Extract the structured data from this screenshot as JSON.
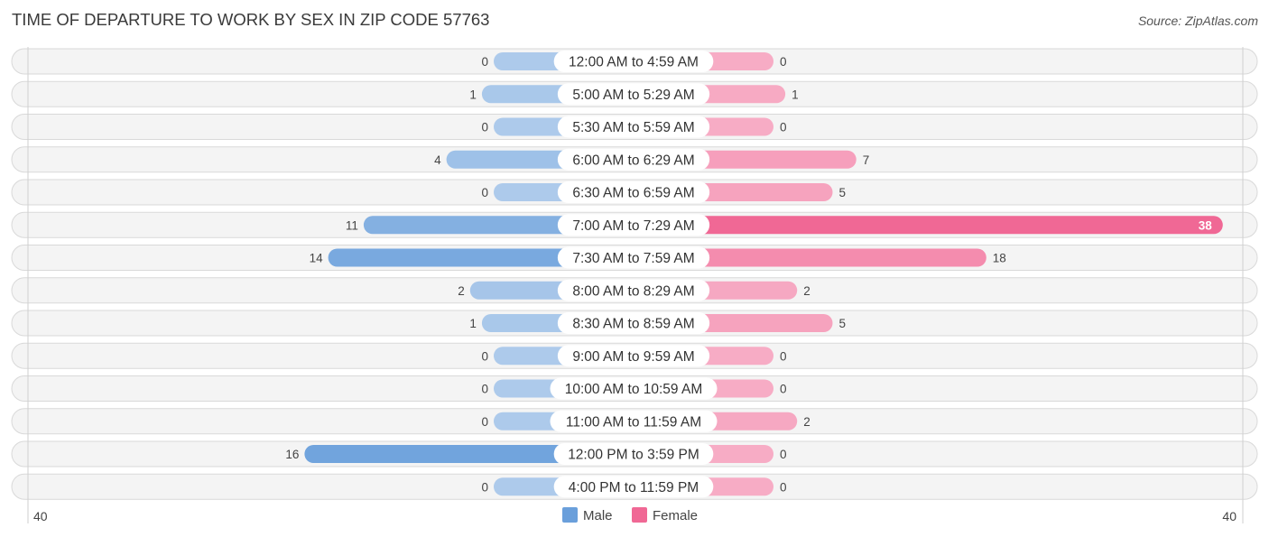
{
  "title": "TIME OF DEPARTURE TO WORK BY SEX IN ZIP CODE 57763",
  "source": "Source: ZipAtlas.com",
  "chart_data": {
    "type": "bar",
    "orientation": "horizontal-diverging",
    "title": "TIME OF DEPARTURE TO WORK BY SEX IN ZIP CODE 57763",
    "categories": [
      "12:00 AM to 4:59 AM",
      "5:00 AM to 5:29 AM",
      "5:30 AM to 5:59 AM",
      "6:00 AM to 6:29 AM",
      "6:30 AM to 6:59 AM",
      "7:00 AM to 7:29 AM",
      "7:30 AM to 7:59 AM",
      "8:00 AM to 8:29 AM",
      "8:30 AM to 8:59 AM",
      "9:00 AM to 9:59 AM",
      "10:00 AM to 10:59 AM",
      "11:00 AM to 11:59 AM",
      "12:00 PM to 3:59 PM",
      "4:00 PM to 11:59 PM"
    ],
    "series": [
      {
        "name": "Male",
        "color": "#6a9fdb",
        "values": [
          0,
          1,
          0,
          4,
          0,
          11,
          14,
          2,
          1,
          0,
          0,
          0,
          16,
          0
        ]
      },
      {
        "name": "Female",
        "color": "#f06895",
        "values": [
          0,
          1,
          0,
          7,
          5,
          38,
          18,
          2,
          5,
          0,
          0,
          2,
          0,
          0
        ]
      }
    ],
    "xlim": [
      -40,
      40
    ],
    "axis_labels": {
      "left": "40",
      "right": "40"
    },
    "legend": {
      "position": "bottom-center",
      "entries": [
        "Male",
        "Female"
      ]
    },
    "grid": false
  }
}
